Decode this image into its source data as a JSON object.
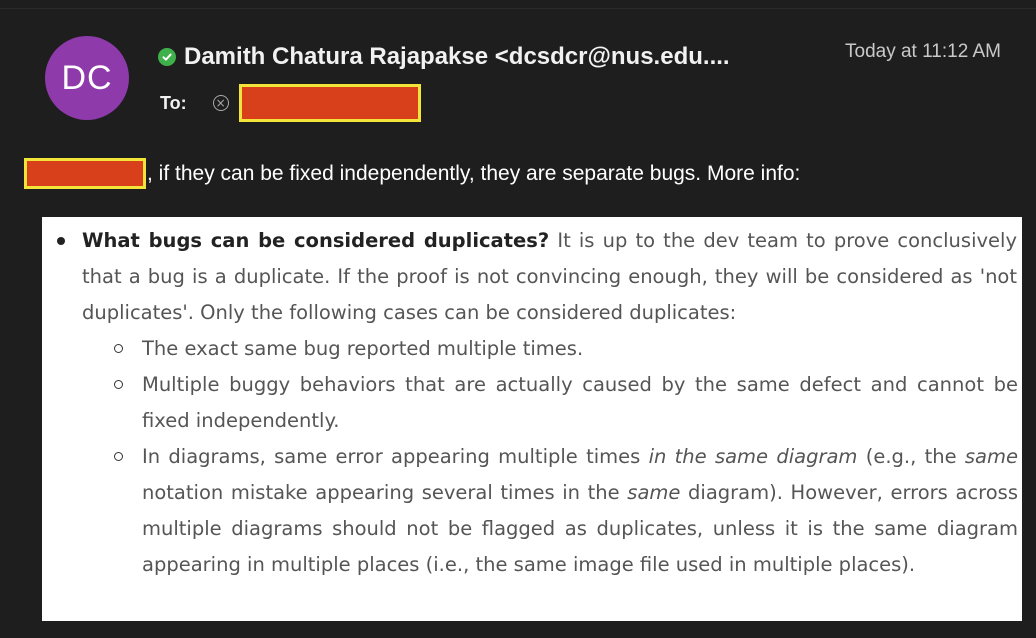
{
  "email": {
    "sender": "Damith Chatura Rajapakse <dcsdcr@nus.edu....",
    "avatar_initials": "DC",
    "timestamp": "Today at 11:12 AM",
    "to_label": "To:",
    "greeting_text": ", if they can be fixed independently, they are separate bugs. More info:"
  },
  "quote": {
    "bullet": {
      "heading": "What bugs can be considered duplicates?",
      "text": " It is up to the dev team to prove conclusively that a bug is a duplicate. If the proof is not convincing enough, they will be considered as 'not duplicates'. Only the following cases can be considered duplicates:"
    },
    "sub_items": [
      {
        "text": "The exact same bug reported multiple times."
      },
      {
        "text": "Multiple buggy behaviors that are actually caused by the same defect and cannot be fixed independently."
      },
      {
        "p1": "In diagrams, same error appearing multiple times ",
        "em1": "in the same diagram",
        "p2": " (e.g., the ",
        "em2": "same",
        "p3": " notation mistake appearing several times in the ",
        "em3": "same",
        "p4": " diagram). However, errors across multiple diagrams should not be flagged as duplicates, unless it is the same diagram appearing in multiple places (i.e., the same image file used in multiple places)."
      }
    ]
  },
  "colors": {
    "avatar_bg": "#8e3aab",
    "verified": "#3fb14b",
    "redaction_fill": "#d8401c",
    "redaction_border": "#f3e43a",
    "background": "#1e1e1f"
  }
}
